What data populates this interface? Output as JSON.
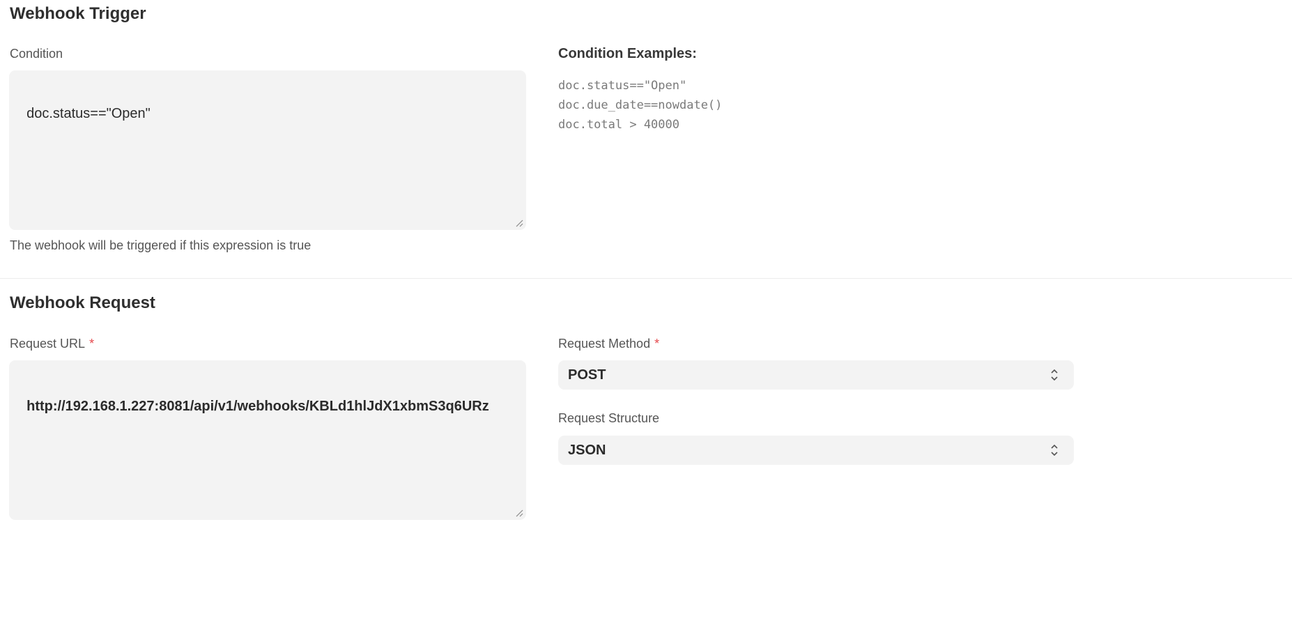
{
  "trigger": {
    "title": "Webhook Trigger",
    "condition_label": "Condition",
    "condition_value": "doc.status==\"Open\"",
    "condition_help": "The webhook will be triggered if this expression is true",
    "examples_title": "Condition Examples:",
    "examples": [
      "doc.status==\"Open\"",
      "doc.due_date==nowdate()",
      "doc.total > 40000"
    ]
  },
  "request": {
    "title": "Webhook Request",
    "url_label": "Request URL",
    "required_marker": "*",
    "url_value": "http://192.168.1.227:8081/api/v1/webhooks/KBLd1hlJdX1xbmS3q6URz",
    "method_label": "Request Method",
    "method_value": "POST",
    "structure_label": "Request Structure",
    "structure_value": "JSON"
  },
  "icons": {
    "resize": "resize-grip-icon",
    "select": "chevron-up-down-icon"
  },
  "colors": {
    "field_bg": "#f3f3f3",
    "required": "#e5484d",
    "divider": "#ececec"
  }
}
